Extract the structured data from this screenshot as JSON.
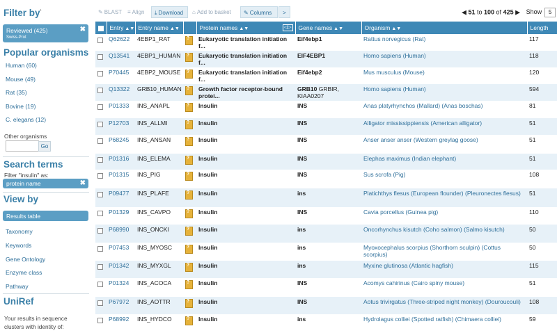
{
  "sidebar": {
    "filter_title": "Filter by",
    "filter_sup": "¹",
    "reviewed_label": "Reviewed (425)",
    "reviewed_sub": "Swiss-Prot",
    "popular_title": "Popular organisms",
    "organisms": [
      "Human (60)",
      "Mouse (49)",
      "Rat (35)",
      "Bovine (19)",
      "C. elegans (12)"
    ],
    "other_label": "Other organisms",
    "go_label": "Go",
    "search_title": "Search terms",
    "search_filter_text": "Filter \"insulin\" as:",
    "search_term": "protein name",
    "view_title": "View by",
    "view_active": "Results table",
    "view_items": [
      "Taxonomy",
      "Keywords",
      "Gene Ontology",
      "Enzyme class",
      "Pathway"
    ],
    "uniref_title": "UniRef",
    "uniref_text1": "Your results in sequence",
    "uniref_text2": "clusters with identity of:"
  },
  "toolbar": {
    "blast": "BLAST",
    "align": "Align",
    "download": "Download",
    "basket": "Add to basket",
    "columns": "Columns",
    "share": ">"
  },
  "pager": {
    "from": "51",
    "to_word": "to",
    "to": "100",
    "of_word": "of",
    "total": "425",
    "show_label": "Show",
    "show_value": "5"
  },
  "table": {
    "headers": {
      "entry": "Entry",
      "entry_name": "Entry name",
      "protein_names": "Protein names",
      "gene_names": "Gene names",
      "organism": "Organism",
      "length": "Length"
    },
    "rows": [
      {
        "entry": "Q62622",
        "name": "4EBP1_RAT",
        "protein": "Eukaryotic translation initiation f...",
        "gene": "Eif4ebp1",
        "gene_extra": "",
        "organism": "Rattus norvegicus (Rat)",
        "length": "117"
      },
      {
        "entry": "Q13541",
        "name": "4EBP1_HUMAN",
        "protein": "Eukaryotic translation initiation f...",
        "gene": "EIF4EBP1",
        "gene_extra": "",
        "organism": "Homo sapiens (Human)",
        "length": "118"
      },
      {
        "entry": "P70445",
        "name": "4EBP2_MOUSE",
        "protein": "Eukaryotic translation initiation f...",
        "gene": "Eif4ebp2",
        "gene_extra": "",
        "organism": "Mus musculus (Mouse)",
        "length": "120"
      },
      {
        "entry": "Q13322",
        "name": "GRB10_HUMAN",
        "protein": "Growth factor receptor-bound protei...",
        "gene": "GRB10",
        "gene_extra": " GRBIR, KIAA0207",
        "organism": "Homo sapiens (Human)",
        "length": "594"
      },
      {
        "entry": "P01333",
        "name": "INS_ANAPL",
        "protein": "Insulin",
        "gene": "INS",
        "gene_extra": "",
        "organism": "Anas platyrhynchos (Mallard) (Anas boschas)",
        "length": "81"
      },
      {
        "entry": "P12703",
        "name": "INS_ALLMI",
        "protein": "Insulin",
        "gene": "INS",
        "gene_extra": "",
        "organism": "Alligator mississippiensis (American alligator)",
        "length": "51"
      },
      {
        "entry": "P68245",
        "name": "INS_ANSAN",
        "protein": "Insulin",
        "gene": "INS",
        "gene_extra": "",
        "organism": "Anser anser anser (Western greylag goose)",
        "length": "51"
      },
      {
        "entry": "P01316",
        "name": "INS_ELEMA",
        "protein": "Insulin",
        "gene": "INS",
        "gene_extra": "",
        "organism": "Elephas maximus (Indian elephant)",
        "length": "51"
      },
      {
        "entry": "P01315",
        "name": "INS_PIG",
        "protein": "Insulin",
        "gene": "INS",
        "gene_extra": "",
        "organism": "Sus scrofa (Pig)",
        "length": "108"
      },
      {
        "entry": "P09477",
        "name": "INS_PLAFE",
        "protein": "Insulin",
        "gene": "ins",
        "gene_extra": "",
        "organism": "Platichthys flesus (European flounder) (Pleuronectes flesus)",
        "length": "51"
      },
      {
        "entry": "P01329",
        "name": "INS_CAVPO",
        "protein": "Insulin",
        "gene": "INS",
        "gene_extra": "",
        "organism": "Cavia porcellus (Guinea pig)",
        "length": "110"
      },
      {
        "entry": "P68990",
        "name": "INS_ONCKI",
        "protein": "Insulin",
        "gene": "ins",
        "gene_extra": "",
        "organism": "Oncorhynchus kisutch (Coho salmon) (Salmo kisutch)",
        "length": "50"
      },
      {
        "entry": "P07453",
        "name": "INS_MYOSC",
        "protein": "Insulin",
        "gene": "ins",
        "gene_extra": "",
        "organism": "Myoxocephalus scorpius (Shorthorn sculpin) (Cottus scorpius)",
        "length": "50"
      },
      {
        "entry": "P01342",
        "name": "INS_MYXGL",
        "protein": "Insulin",
        "gene": "ins",
        "gene_extra": "",
        "organism": "Myxine glutinosa (Atlantic hagfish)",
        "length": "115"
      },
      {
        "entry": "P01324",
        "name": "INS_ACOCA",
        "protein": "Insulin",
        "gene": "INS",
        "gene_extra": "",
        "organism": "Acomys cahirinus (Cairo spiny mouse)",
        "length": "51"
      },
      {
        "entry": "P67972",
        "name": "INS_AOTTR",
        "protein": "Insulin",
        "gene": "INS",
        "gene_extra": "",
        "organism": "Aotus trivirgatus (Three-striped night monkey) (Douroucouli)",
        "length": "108"
      },
      {
        "entry": "P68992",
        "name": "INS_HYDCO",
        "protein": "Insulin",
        "gene": "ins",
        "gene_extra": "",
        "organism": "Hydrolagus colliei (Spotted ratfish) (Chimaera colliei)",
        "length": "59"
      }
    ]
  },
  "colors": {
    "accent": "#3e88b6",
    "link": "#2e6f9a",
    "row_alt": "#e7f1f8",
    "pill": "#5b9ec4"
  },
  "icons": {
    "doc_icon": "unreviewed-doc-icon"
  }
}
